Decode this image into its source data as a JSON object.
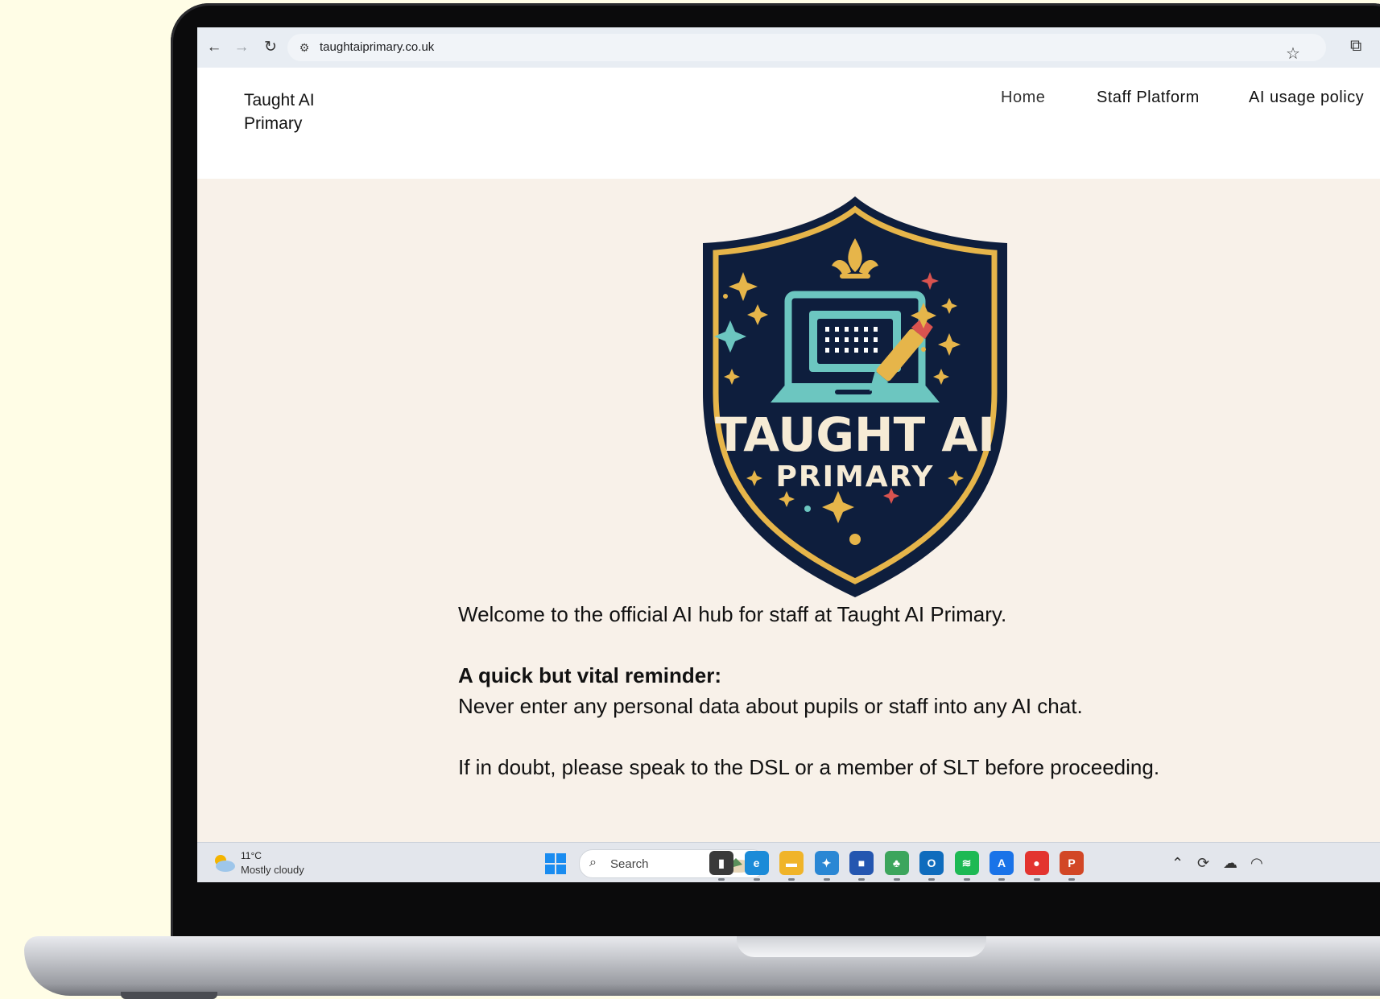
{
  "browser": {
    "url": "taughtaiprimary.co.uk",
    "back": "←",
    "forward": "→",
    "reload": "↻"
  },
  "site": {
    "title": "Taught AI Primary",
    "nav": [
      "Home",
      "Staff Platform",
      "AI usage policy"
    ]
  },
  "crest": {
    "line1": "TAUGHT AI",
    "line2": "PRIMARY",
    "colors": {
      "navy": "#0e1e3d",
      "gold": "#e6b54a",
      "teal": "#6cc6c0",
      "red": "#d9534f"
    }
  },
  "content": {
    "welcome": "Welcome to the official AI hub for staff at Taught AI Primary.",
    "reminder_heading": "A quick but vital reminder:",
    "reminder_text": "Never enter any personal data about pupils or staff into any AI chat.",
    "doubt_text": "If in doubt, please speak to the DSL or a member of SLT before proceeding."
  },
  "taskbar": {
    "weather_temp": "11°C",
    "weather_condition": "Mostly cloudy",
    "search_placeholder": "Search",
    "apps": [
      {
        "name": "task-view",
        "glyph": "▮",
        "color": "#3a3a3a"
      },
      {
        "name": "edge",
        "glyph": "e",
        "color": "#1b8bd8"
      },
      {
        "name": "file-explorer",
        "glyph": "▬",
        "color": "#f0b429"
      },
      {
        "name": "copilot-pre",
        "glyph": "✦",
        "color": "#2a87d4"
      },
      {
        "name": "microsoft-store",
        "glyph": "■",
        "color": "#2456b0"
      },
      {
        "name": "photos-app",
        "glyph": "♣",
        "color": "#3ca55c"
      },
      {
        "name": "outlook",
        "glyph": "O",
        "color": "#0f6cbd"
      },
      {
        "name": "spotify",
        "glyph": "≋",
        "color": "#1db954"
      },
      {
        "name": "azure-app",
        "glyph": "A",
        "color": "#1a73e8"
      },
      {
        "name": "chrome",
        "glyph": "●",
        "color": "#e3342f"
      },
      {
        "name": "powerpoint",
        "glyph": "P",
        "color": "#d24726"
      }
    ]
  }
}
